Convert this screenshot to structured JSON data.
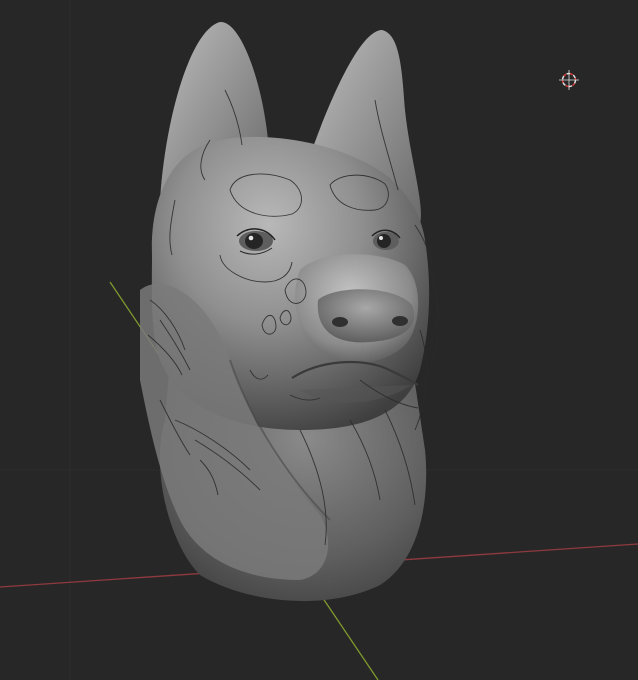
{
  "viewport": {
    "background": "#272727",
    "grid_line_color": "#2f2f2f",
    "x_axis_color": "#8f3a3f",
    "y_axis_color": "#7f9a2e",
    "cursor_colors": [
      "#e0e0e0",
      "#d83a3a"
    ]
  },
  "objects": [
    {
      "name": "dog-head-sculpt",
      "kind": "sculpted mesh",
      "color": "#8d8d8d",
      "has_sketch_overlay": true
    }
  ],
  "icons": {
    "cursor": "3d-cursor-icon"
  }
}
